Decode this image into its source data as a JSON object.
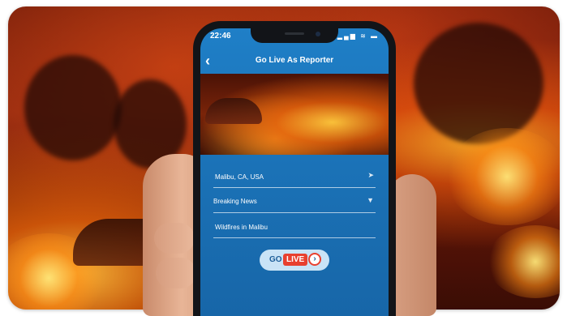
{
  "status": {
    "time": "22:46",
    "icons": "▂▄▆ ≋ ▬"
  },
  "nav": {
    "back_icon": "‹",
    "title": "Go Live As Reporter"
  },
  "form": {
    "location": {
      "value": "Malibu, CA, USA",
      "icon": "location-arrow-icon"
    },
    "category": {
      "value": "Breaking News",
      "icon": "dropdown-triangle-icon"
    },
    "headline": {
      "value": "Wildfires in Malibu"
    }
  },
  "go_live_button": {
    "go": "GO",
    "live": "LIVE",
    "arrow": "›"
  },
  "colors": {
    "primary_blue": "#1f7fc7",
    "live_red": "#e8402f",
    "button_bg": "#c9e3f6"
  }
}
